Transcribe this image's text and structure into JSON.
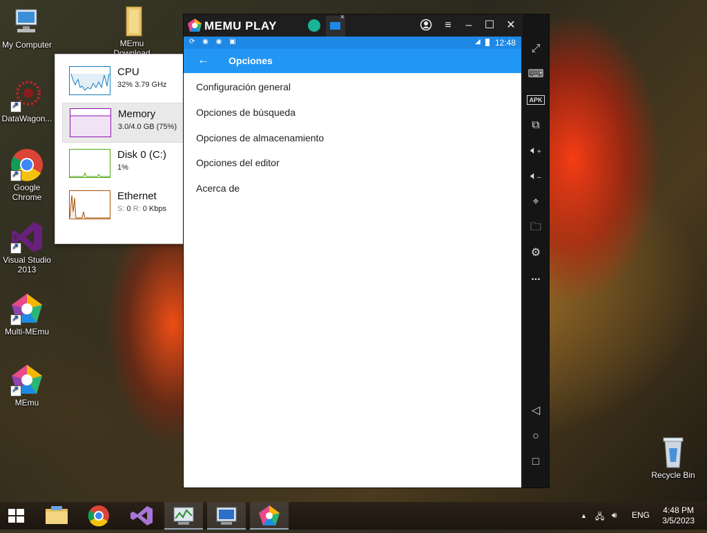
{
  "desktop": {
    "icons": [
      {
        "label": "My Computer"
      },
      {
        "label": "MEmu Download"
      },
      {
        "label": "DataWagon..."
      },
      {
        "label": "Google Chrome"
      },
      {
        "label": "Visual Studio 2013"
      },
      {
        "label": "Multi-MEmu"
      },
      {
        "label": "MEmu"
      },
      {
        "label": "Recycle Bin"
      }
    ]
  },
  "taskmgr": {
    "rows": [
      {
        "title": "CPU",
        "sub": "32%  3.79 GHz"
      },
      {
        "title": "Memory",
        "sub": "3.0/4.0 GB (75%)"
      },
      {
        "title": "Disk 0 (C:)",
        "sub": "1%"
      },
      {
        "title": "Ethernet",
        "sub_s_label": "S:",
        "sub_s": "0",
        "sub_r_label": "R:",
        "sub_r": "0 Kbps"
      }
    ],
    "colors": {
      "cpu": "#117dbb",
      "memory": "#8b12ae",
      "disk": "#4da60c",
      "ethernet": "#a74f01"
    }
  },
  "memu": {
    "brand": "MEMU PLAY",
    "title_buttons": [
      "account-icon",
      "menu-icon",
      "minimize-icon",
      "maximize-icon",
      "close-icon",
      "collapse-icon"
    ],
    "statusbar": {
      "time": "12:48"
    },
    "appbar": {
      "title": "Opciones"
    },
    "options": [
      "Configuración general",
      "Opciones de búsqueda",
      "Opciones de almacenamiento",
      "Opciones del editor",
      "Acerca de"
    ],
    "sidebar_icons": [
      "fullscreen-icon",
      "keyboard-icon",
      "apk-icon",
      "multi-window-icon",
      "volume-up-icon",
      "volume-down-icon",
      "location-icon",
      "folder-icon",
      "settings-icon",
      "more-icon",
      "back-icon",
      "home-icon",
      "recent-apps-icon"
    ],
    "apk_label": "APK",
    "more_label": "..."
  },
  "taskbar": {
    "lang": "ENG",
    "time": "4:48 PM",
    "date": "3/5/2023"
  }
}
